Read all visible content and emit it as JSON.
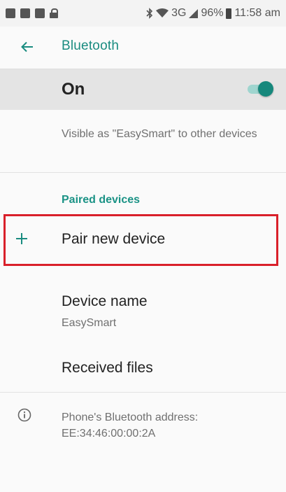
{
  "status_bar": {
    "signal_text": "3G",
    "battery": "96%",
    "time": "11:58 am"
  },
  "toolbar": {
    "title": "Bluetooth",
    "back_icon": "arrow-back-icon"
  },
  "master_switch": {
    "label": "On",
    "state": true,
    "accent_color": "#16887c"
  },
  "visibility_text": "Visible as \"EasySmart\" to other devices",
  "paired_section": {
    "header": "Paired devices"
  },
  "pair_new_device": {
    "label": "Pair new device",
    "icon": "plus-icon",
    "highlight_color": "#d9202a"
  },
  "device_name": {
    "title": "Device name",
    "value": "EasySmart"
  },
  "received_files": {
    "title": "Received files"
  },
  "bluetooth_address": {
    "icon": "info-icon",
    "text": "Phone's Bluetooth address: EE:34:46:00:00:2A"
  }
}
